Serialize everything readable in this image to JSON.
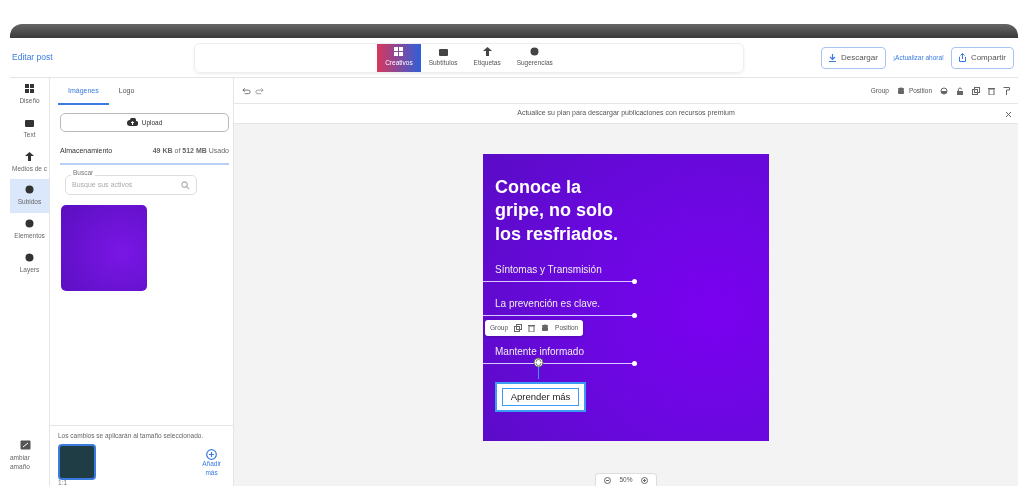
{
  "header": {
    "title": "Editar post",
    "tabs": [
      {
        "label": "Creativos",
        "selected": true
      },
      {
        "label": "Subtítulos",
        "selected": false
      },
      {
        "label": "Etiquetas",
        "selected": false
      },
      {
        "label": "Sugerencias",
        "selected": false
      }
    ],
    "download": "Descargar",
    "upgrade": "¡Actualizar ahora!",
    "share": "Compartir"
  },
  "rail": {
    "items": [
      {
        "label": "Diseño",
        "selected": false
      },
      {
        "label": "Text",
        "selected": false
      },
      {
        "label": "Medios de c",
        "selected": false
      },
      {
        "label": "Subidos",
        "selected": true
      },
      {
        "label": "Elementos",
        "selected": false
      },
      {
        "label": "Layers",
        "selected": false
      }
    ],
    "resize_label": [
      "ambiar",
      "amaño"
    ]
  },
  "panel": {
    "tabs": [
      {
        "label": "Imágenes",
        "selected": true
      },
      {
        "label": "Logo",
        "selected": false
      }
    ],
    "upload": "Upload",
    "storage_label": "Almacenamiento",
    "storage_usage": "**49 KB** of **512 MB** Usado",
    "search": {
      "label": "Buscar",
      "placeholder": "Busque sus activos"
    },
    "resize_note": "Los cambios se aplicarán al tamaño seleccionado.",
    "add_more": [
      "Añadir",
      "más"
    ],
    "ratio": "1:1"
  },
  "toolbar": {
    "group": "Group",
    "position": "Position"
  },
  "banner": {
    "text": "Actualice su plan para descargar publicaciones con recursos premium"
  },
  "poster": {
    "title": "Conoce la gripe, no solo los resfriados.",
    "items": [
      "Síntomas y Transmisión",
      "La prevención es clave.",
      "Mantente informado"
    ],
    "button": "Aprender más"
  },
  "selection_toolbar": {
    "group": "Group",
    "position": "Position"
  },
  "zoom": {
    "value": "50%"
  }
}
